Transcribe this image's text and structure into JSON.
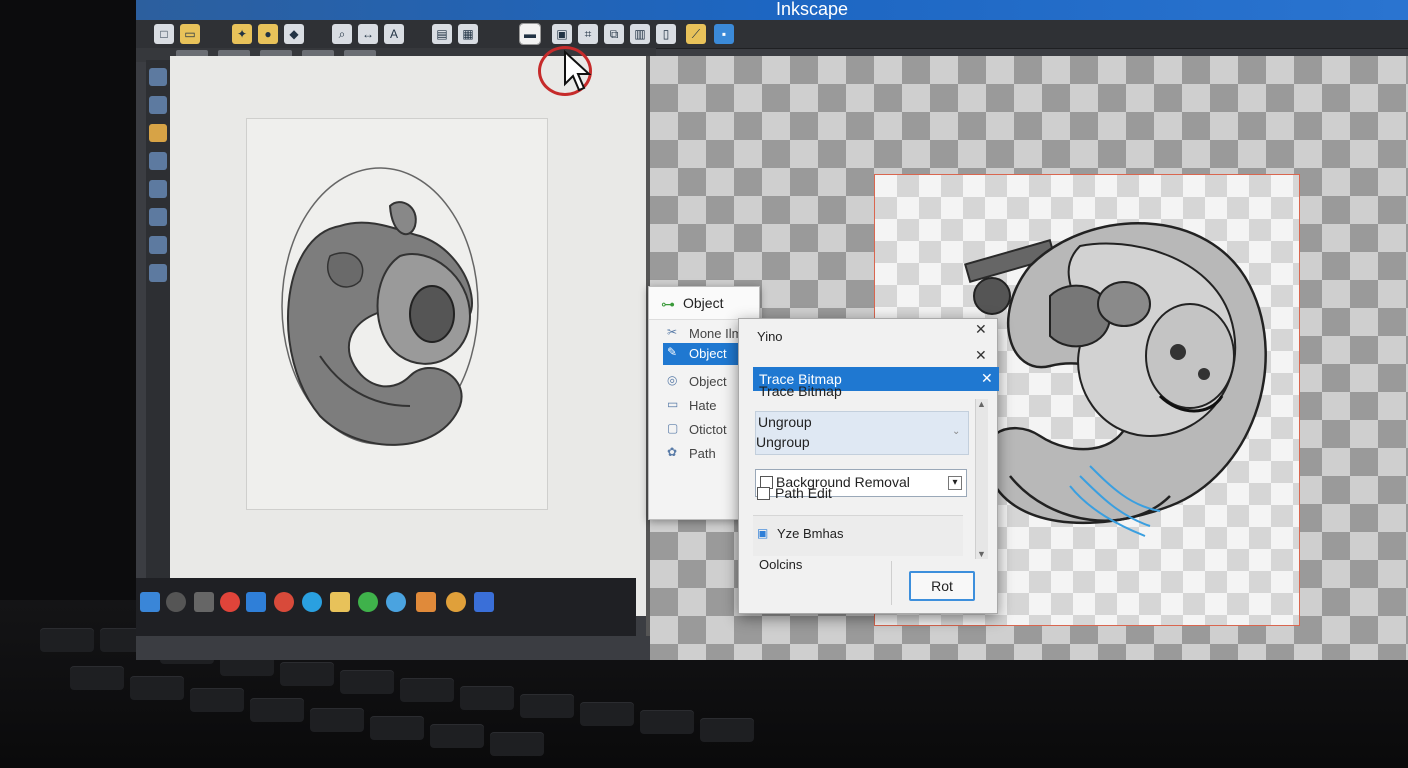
{
  "window": {
    "title": "Inkscape"
  },
  "object_panel": {
    "header": "Object",
    "items": [
      {
        "label": "Mone Ilmm",
        "icon": "scissors-icon"
      },
      {
        "label": "Object",
        "icon": "pencil-icon",
        "selected": true
      },
      {
        "label": "Object",
        "icon": "object-icon"
      },
      {
        "label": "Hate",
        "icon": "page-icon"
      },
      {
        "label": "Otictot",
        "icon": "box-icon"
      },
      {
        "label": "Path",
        "icon": "path-icon"
      }
    ]
  },
  "trace_dialog": {
    "top_label": "Yino",
    "selected_item": "Trace Bitmap",
    "trace_label": "Trace Bitmap",
    "ungroup_1": "Ungroup",
    "ungroup_2": "Ungroup",
    "background_removal": "Background Removal",
    "path_edit": "Path Edit",
    "size_label": "Yze Bmhas",
    "footer_label": "Oolcins",
    "ok_button": "Rot"
  },
  "colors": {
    "accent": "#1f78d1",
    "titlebar": "#1d66c2",
    "highlight_ring": "#c62b2b",
    "artboard_border": "#d9664f"
  }
}
